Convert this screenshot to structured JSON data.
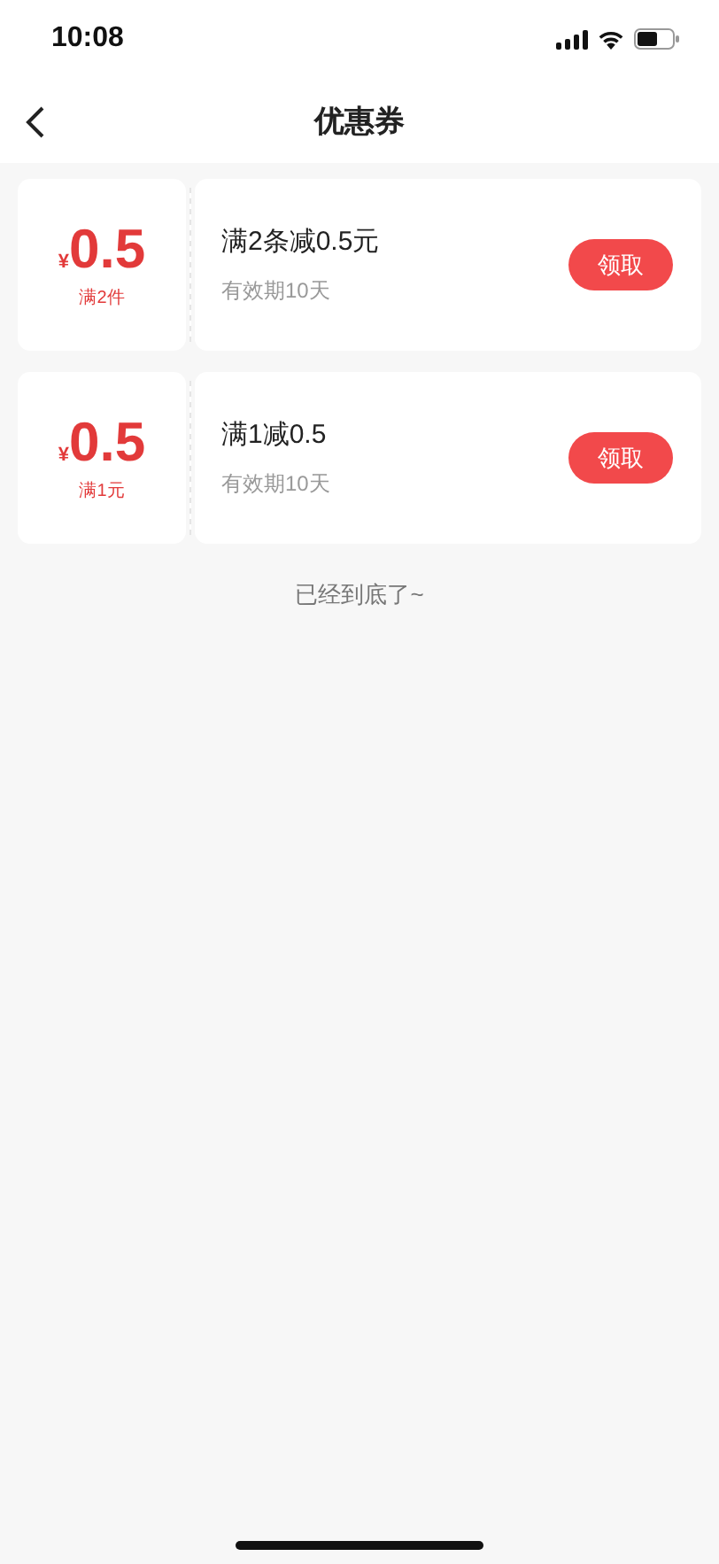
{
  "status_bar": {
    "time": "10:08"
  },
  "nav": {
    "title": "优惠券"
  },
  "coupons": [
    {
      "currency": "¥",
      "amount": "0.5",
      "condition": "满2件",
      "title": "满2条减0.5元",
      "validity": "有效期10天",
      "button": "领取"
    },
    {
      "currency": "¥",
      "amount": "0.5",
      "condition": "满1元",
      "title": "满1减0.5",
      "validity": "有效期10天",
      "button": "领取"
    }
  ],
  "end_text": "已经到底了~"
}
